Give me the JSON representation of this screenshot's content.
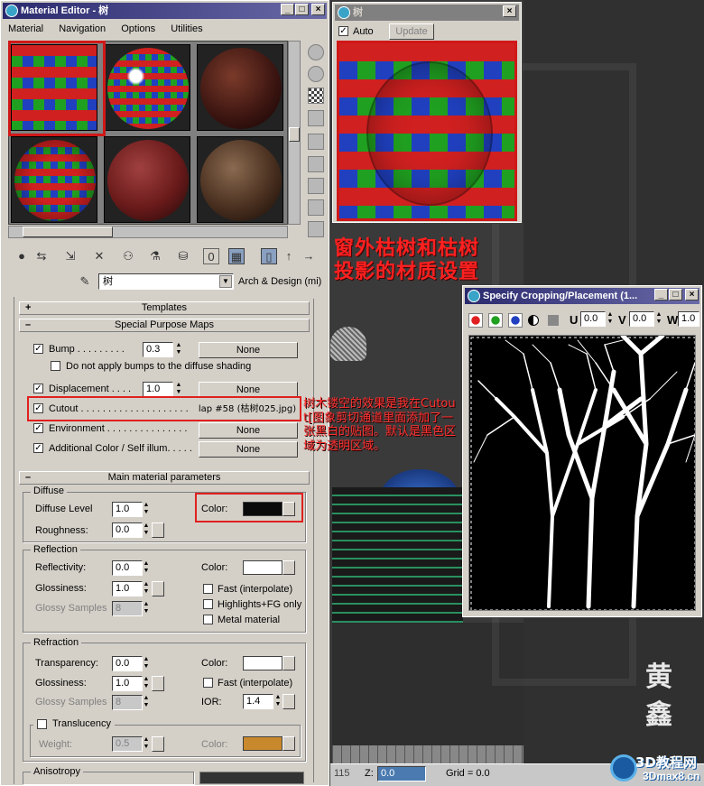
{
  "me": {
    "title": "Material Editor - 树",
    "menu": [
      "Material",
      "Navigation",
      "Options",
      "Utilities"
    ],
    "material_name": "树",
    "material_type": "Arch & Design (mi)",
    "rollouts": {
      "templates": "Templates",
      "special": "Special Purpose Maps",
      "main": "Main material parameters",
      "aniso": "Anisotropy"
    },
    "bump": {
      "label": "Bump . . . . . . . . .",
      "value": "0.3",
      "map": "None"
    },
    "bump_opt": "Do not apply bumps to the diffuse shading",
    "displacement": {
      "label": "Displacement . . . .",
      "value": "1.0",
      "map": "None"
    },
    "cutout": {
      "label": "Cutout . . . . . . . . . . . . . . . . . . . .",
      "map": "lap #58 (枯树025.jpg)"
    },
    "environment": {
      "label": "Environment . . . . . . . . . . . . . . .",
      "map": "None"
    },
    "addcolor": {
      "label": "Additional Color / Self illum. . . . .",
      "map": "None"
    },
    "diffuse": {
      "group": "Diffuse",
      "level_label": "Diffuse Level",
      "level": "1.0",
      "rough_label": "Roughness:",
      "rough": "0.0",
      "color_label": "Color:",
      "color": "#0a0a0a"
    },
    "reflection": {
      "group": "Reflection",
      "refl_label": "Reflectivity:",
      "refl": "0.0",
      "gloss_label": "Glossiness:",
      "gloss": "1.0",
      "samples_label": "Glossy Samples",
      "samples": "8",
      "color_label": "Color:",
      "color": "#ffffff",
      "opt1": "Fast (interpolate)",
      "opt2": "Highlights+FG only",
      "opt3": "Metal material"
    },
    "refraction": {
      "group": "Refraction",
      "trans_label": "Transparency:",
      "trans": "0.0",
      "gloss_label": "Glossiness:",
      "gloss": "1.0",
      "samples_label": "Glossy Samples",
      "samples": "8",
      "color_label": "Color:",
      "color": "#ffffff",
      "opt1": "Fast (interpolate)",
      "ior_label": "IOR:",
      "ior": "1.4"
    },
    "translucency": {
      "label": "Translucency",
      "weight_label": "Weight:",
      "weight": "0.5",
      "color_label": "Color:",
      "color": "#c8882c"
    }
  },
  "preview": {
    "title": "树",
    "auto": "Auto",
    "update": "Update"
  },
  "cropping": {
    "title": "Specify Cropping/Placement (1...",
    "u_label": "U",
    "u": "0.0",
    "v_label": "V",
    "v": "0.0",
    "w_label": "W",
    "w": "1.0"
  },
  "annotations": {
    "heading_line1": "窗外枯树和枯树",
    "heading_line2": "投影的材质设置",
    "note": "树木镂空的效果是我在Cutout[图象剪切通道里面添加了一张黑白的贴图。默认是黑色区域为透明区域。"
  },
  "statusbar": {
    "coord": "115",
    "z_label": "Z:",
    "z": "0.0",
    "grid": "Grid = 0.0"
  },
  "watermark": {
    "brand": "3D教程网",
    "url": "3Dmax8.cn"
  }
}
